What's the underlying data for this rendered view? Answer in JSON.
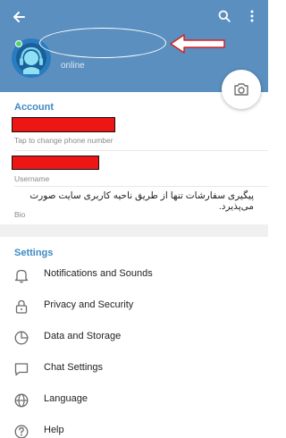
{
  "profile": {
    "status": "online"
  },
  "account": {
    "section_title": "Account",
    "phone_hint": "Tap to change phone number",
    "username_hint": "Username",
    "bio_text": "پیگیری سفارشات تنها از طریق ناحیه کاربری سایت صورت می‌پذیرد.",
    "bio_hint": "Bio"
  },
  "settings": {
    "section_title": "Settings",
    "items": [
      {
        "label": "Notifications and Sounds",
        "icon": "bell-icon"
      },
      {
        "label": "Privacy and Security",
        "icon": "lock-icon"
      },
      {
        "label": "Data and Storage",
        "icon": "pie-chart-icon"
      },
      {
        "label": "Chat Settings",
        "icon": "chat-bubble-icon"
      },
      {
        "label": "Language",
        "icon": "globe-icon"
      },
      {
        "label": "Help",
        "icon": "help-circle-icon"
      }
    ]
  },
  "colors": {
    "header": "#5b8fbf",
    "accent": "#3d8ac5",
    "redacted": "#ee1515",
    "annotation_arrow": "#d62020"
  }
}
